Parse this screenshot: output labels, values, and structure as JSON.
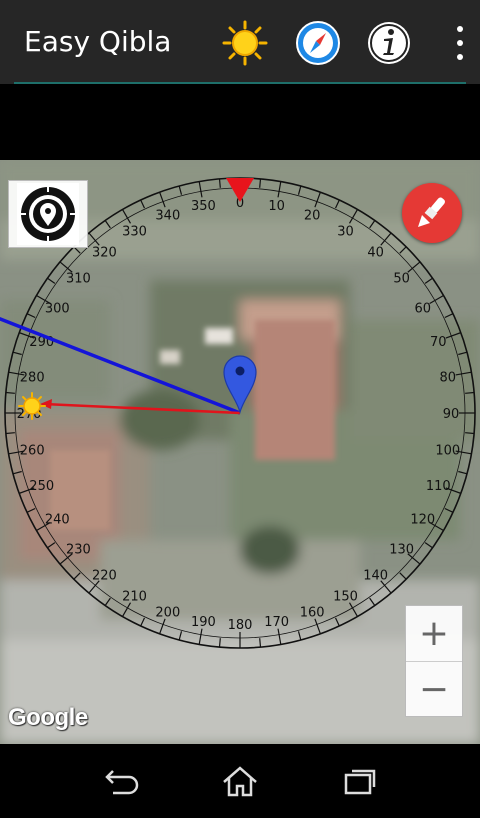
{
  "app": {
    "title": "Easy Qibla"
  },
  "toolbar": {
    "icons": [
      "sun-icon",
      "compass-icon",
      "info-icon",
      "overflow-menu-icon"
    ]
  },
  "compass": {
    "north_label": "0",
    "tick_labels": [
      "0",
      "10",
      "20",
      "30",
      "40",
      "50",
      "60",
      "70",
      "80",
      "90",
      "100",
      "110",
      "120",
      "130",
      "140",
      "150",
      "160",
      "170",
      "180",
      "190",
      "200",
      "210",
      "220",
      "230",
      "240",
      "250",
      "260",
      "270",
      "280",
      "290",
      "300",
      "310",
      "320",
      "330",
      "340",
      "350"
    ],
    "qibla_line_color": "#1414d8",
    "sun_line_color": "#e0141c",
    "north_marker_color": "#e8141c"
  },
  "map_controls": {
    "zoom_in": "+",
    "zoom_out": "−",
    "attribution": "Google"
  },
  "nav": {
    "icons": [
      "back-icon",
      "home-icon",
      "recent-apps-icon"
    ]
  }
}
